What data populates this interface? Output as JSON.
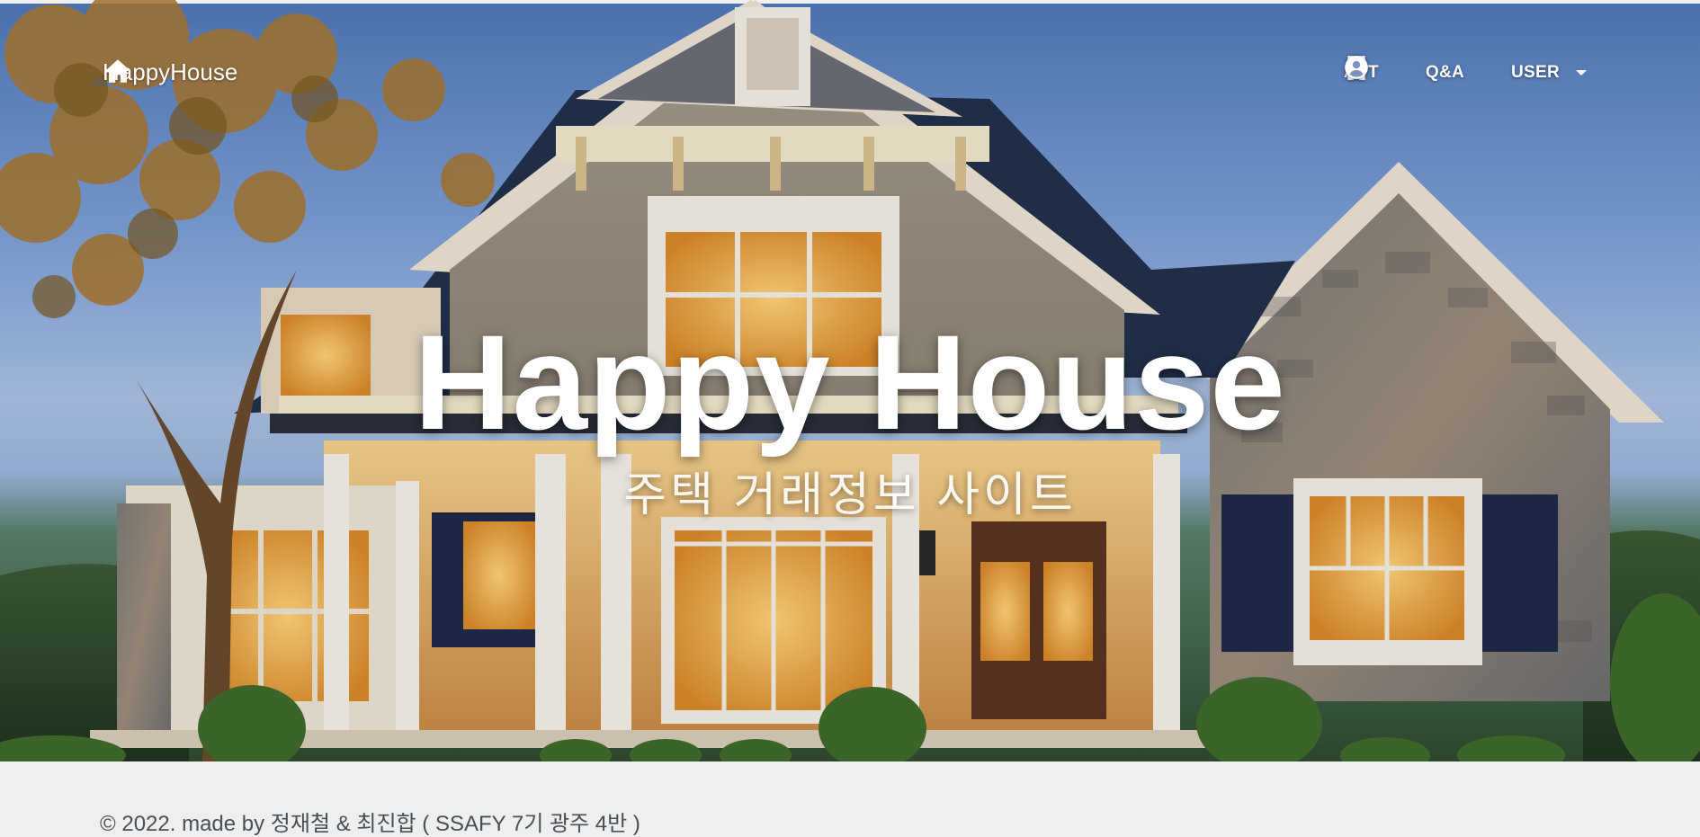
{
  "brand": {
    "name": "HappyHouse",
    "icon": "home-icon"
  },
  "nav": {
    "apt": {
      "label": "APT",
      "icon": "building-icon"
    },
    "qna": {
      "label": "Q&A",
      "icon": "question-icon"
    },
    "user": {
      "label": "USER",
      "icon": "account-circle-icon",
      "dropdown_icon": "caret-down-icon"
    }
  },
  "hero": {
    "title": "Happy House",
    "subtitle": "주택 거래정보 사이트",
    "image": "house-photo"
  },
  "footer": {
    "copyright": "© 2022. made by 정재철 & 최진합 ( SSAFY 7기 광주 4반 )"
  },
  "colors": {
    "text_on_hero": "#ffffff",
    "footer_bg": "#eef0ef",
    "footer_text": "#4a4f55"
  }
}
